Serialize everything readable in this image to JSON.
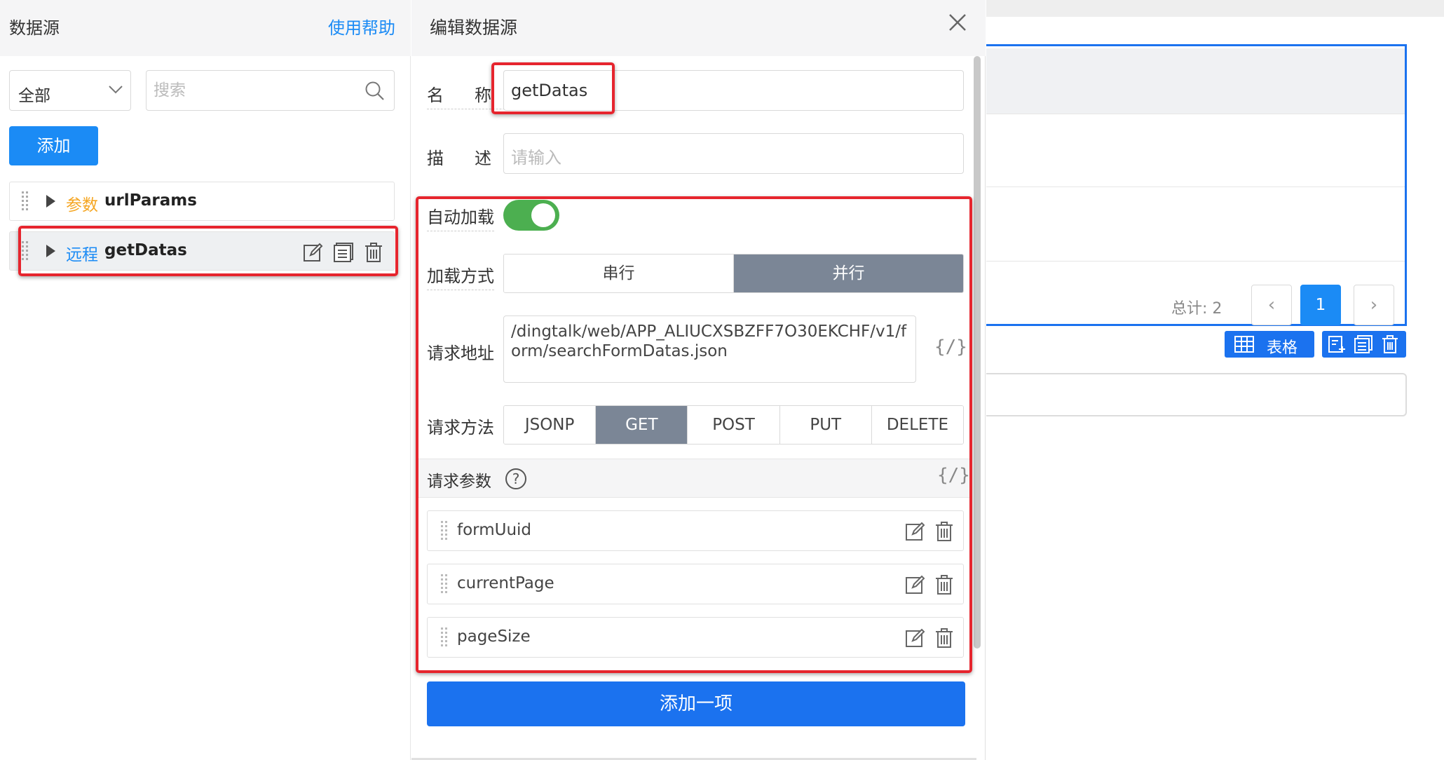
{
  "left_panel": {
    "title": "数据源",
    "help_link": "使用帮助",
    "filter": {
      "selected": "全部"
    },
    "search": {
      "placeholder": "搜索"
    },
    "add_button": "添加",
    "items": [
      {
        "type": "参数",
        "type_color": "#f5a623",
        "name": "urlParams"
      },
      {
        "type": "远程",
        "type_color": "#1b8bf5",
        "name": "getDatas"
      }
    ]
  },
  "editor": {
    "title": "编辑数据源",
    "name_label": "名称",
    "name_value": "getDatas",
    "desc_label": "描述",
    "desc_placeholder": "请输入",
    "autoload_label": "自动加载",
    "autoload_on": true,
    "load_mode_label": "加载方式",
    "load_modes": [
      "串行",
      "并行"
    ],
    "load_mode_selected": "并行",
    "url_label": "请求地址",
    "url_value": "/dingtalk/web/APP_ALIUCXSBZFF7O30EKCHF/v1/form/searchFormDatas.json",
    "code_symbol": "{/}",
    "method_label": "请求方法",
    "methods": [
      "JSONP",
      "GET",
      "POST",
      "PUT",
      "DELETE"
    ],
    "method_selected": "GET",
    "params_label": "请求参数",
    "help_symbol": "?",
    "params": [
      "formUuid",
      "currentPage",
      "pageSize"
    ],
    "add_item_button": "添加一项"
  },
  "canvas": {
    "total_text": "总计: 2",
    "prev_symbol": "‹",
    "next_symbol": "›",
    "current_page": "1",
    "table_tag_label": "表格"
  },
  "colors": {
    "accent": "#1b8bf5",
    "primary_button": "#1b72ef",
    "highlight_frame": "#e6252e",
    "toggle_on": "#4caf50",
    "segment_active": "#7b8696"
  }
}
